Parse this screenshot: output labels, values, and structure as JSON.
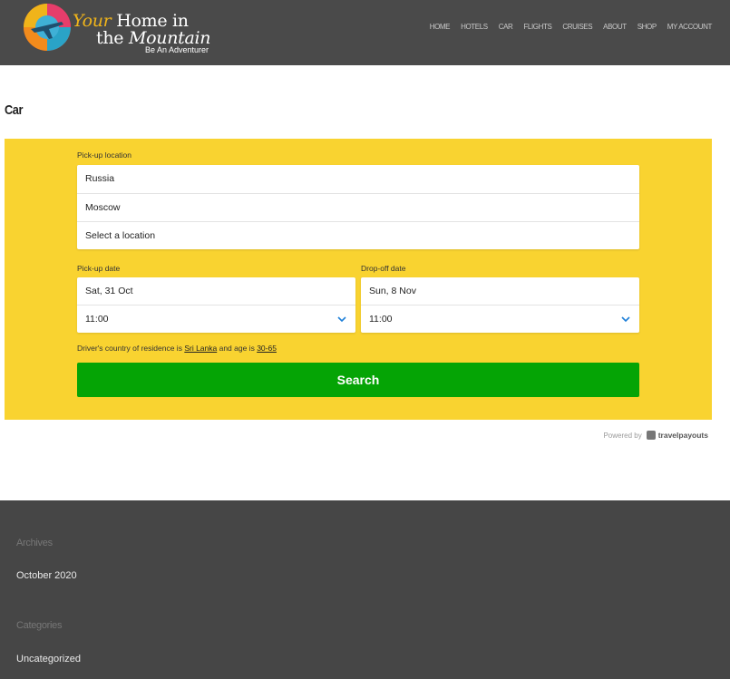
{
  "header": {
    "logo": {
      "line1_accent": "Your",
      "line1_rest": "Home in",
      "line2_prefix": "the ",
      "line2_ital": "Mountain",
      "tagline": "Be An Adventurer"
    },
    "nav": [
      "HOME",
      "HOTELS",
      "CAR",
      "FLIGHTS",
      "CRUISES",
      "ABOUT",
      "SHOP",
      "MY ACCOUNT"
    ]
  },
  "page": {
    "title": "Car"
  },
  "widget": {
    "background": "#f9d330",
    "pickup_location_label": "Pick-up location",
    "location_rows": [
      "Russia",
      "Moscow",
      "Select a location"
    ],
    "pickup_date_label": "Pick-up date",
    "pickup_date": "Sat, 31 Oct",
    "pickup_time": "11:00",
    "dropoff_date_label": "Drop-off date",
    "dropoff_date": "Sun, 8 Nov",
    "dropoff_time": "11:00",
    "residence_note_prefix": "Driver's country of residence is ",
    "residence_country": "Sri Lanka",
    "residence_note_mid": " and age is ",
    "residence_age": "30-65",
    "search_label": "Search",
    "search_color": "#05a405"
  },
  "powered": {
    "prefix": "Powered by",
    "brand": "travelpayouts"
  },
  "footer": {
    "archives_heading": "Archives",
    "archives_link": "October 2020",
    "categories_heading": "Categories",
    "categories_link": "Uncategorized"
  }
}
